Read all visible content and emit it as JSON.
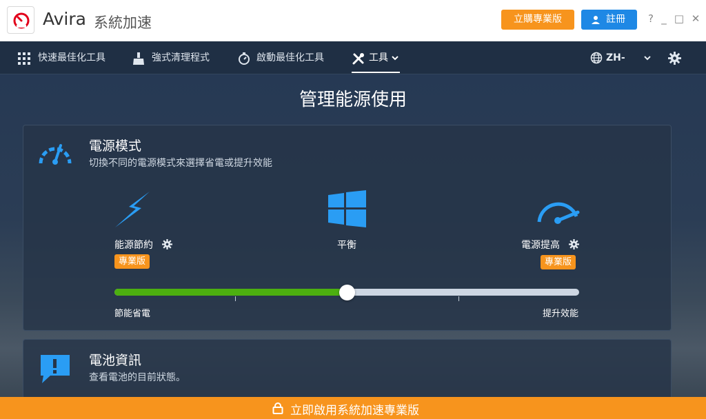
{
  "app": {
    "name": "Avira",
    "subtitle": "系統加速"
  },
  "titlebar": {
    "buy_label": "立購專業版",
    "register_label": "註冊",
    "help": "?",
    "minimize": "_",
    "maximize": "□",
    "close": "✕"
  },
  "nav": {
    "items": [
      {
        "label": "快速最佳化工具",
        "icon": "grid-icon"
      },
      {
        "label": "強式清理程式",
        "icon": "broom-icon"
      },
      {
        "label": "啟動最佳化工具",
        "icon": "stopwatch-icon"
      },
      {
        "label": "工具",
        "icon": "tools-icon",
        "active": true
      }
    ],
    "language": "ZH-CHT"
  },
  "page": {
    "title": "管理能源使用"
  },
  "power_mode": {
    "title": "電源模式",
    "subtitle": "切換不同的電源模式來選擇省電或提升效能",
    "modes": [
      {
        "label": "能源節約",
        "badge": "專業版",
        "icon": "lightning-icon"
      },
      {
        "label": "平衡",
        "icon": "windows-icon"
      },
      {
        "label": "電源提高",
        "badge": "專業版",
        "icon": "speedometer-icon"
      }
    ],
    "slider": {
      "value": 0.5,
      "min_label": "節能省電",
      "max_label": "提升效能"
    }
  },
  "battery": {
    "title": "電池資訊",
    "subtitle": "查看電池的目前狀態。"
  },
  "bottom_bar": {
    "label": "立即啟用系統加速專業版"
  },
  "colors": {
    "accent_orange": "#f7941d",
    "accent_blue": "#1e88e5",
    "green": "#4caf10",
    "icon_blue": "#2a9df4"
  }
}
